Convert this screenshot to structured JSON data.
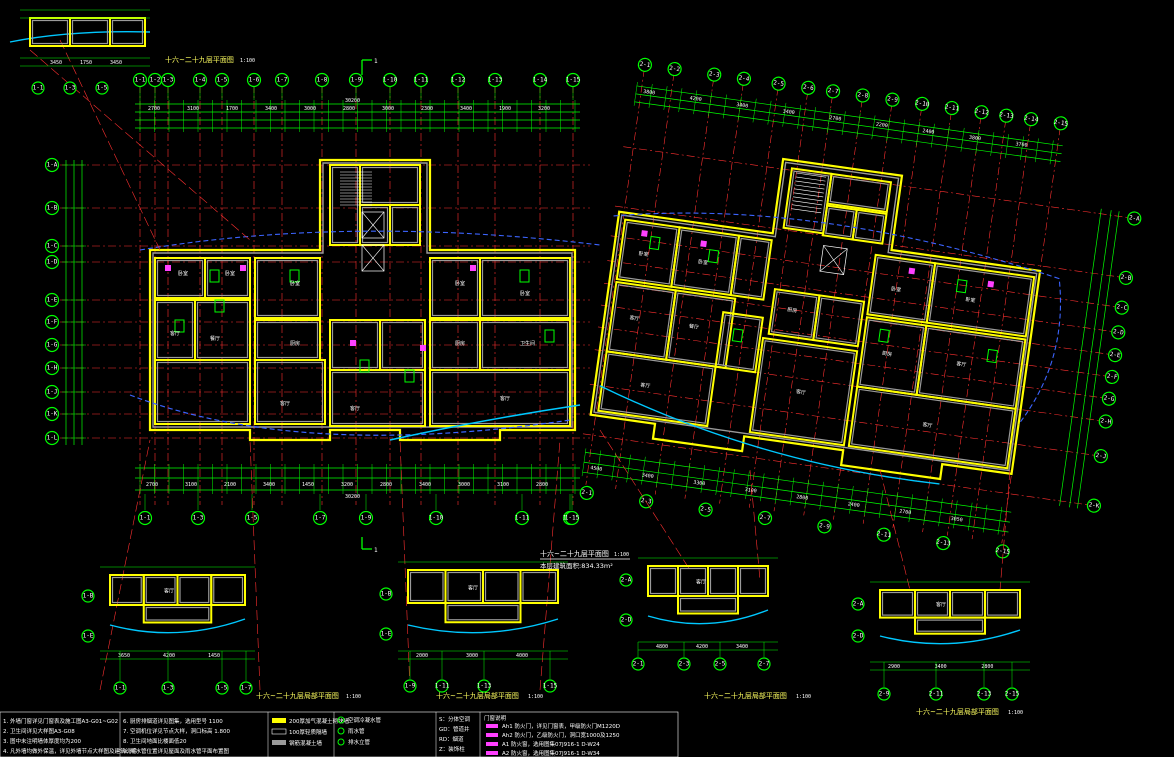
{
  "colors": {
    "background": "#000000",
    "wall": "#ffff00",
    "wall_fill": "#9a9a9a",
    "grid_line": "#ff3030",
    "dimension": "#00ff00",
    "bubble": "#00ff00",
    "text": "#ffffff",
    "cyan": "#00c8ff",
    "blue": "#3c64ff",
    "magenta": "#ff40ff"
  },
  "plan_main": {
    "title": "十六~二十九层平面图",
    "scale": "1:100",
    "area_label": "本层建筑面积:834.33m²",
    "section_mark": "1",
    "left_axes": [
      "1-1",
      "1-2",
      "1-3",
      "1-4",
      "1-5",
      "1-6",
      "1-7",
      "1-8",
      "1-9",
      "1-10",
      "1-11",
      "1-12",
      "1-13",
      "1-14",
      "1-15"
    ],
    "left_bottom_axes": [
      "1-1",
      "1-3",
      "1-5",
      "1-7",
      "1-9",
      "1-10",
      "1-11",
      "1-13",
      "1-15"
    ],
    "left_rows": [
      "1-A",
      "1-B",
      "1-C",
      "1-D",
      "1-E",
      "1-F",
      "1-G",
      "1-H",
      "1-J",
      "1-K",
      "1-L"
    ],
    "left_top_dims": [
      "2700",
      "3100",
      "1700",
      "3400",
      "3000",
      "2800",
      "3000",
      "2300",
      "3400",
      "1900",
      "3200"
    ],
    "left_bottom_dims": [
      "2700",
      "3100",
      "2100",
      "3400",
      "1450",
      "3200",
      "2800",
      "3400",
      "3000",
      "3100",
      "2800"
    ],
    "left_total": "30200",
    "right_axes": [
      "2-1",
      "2-2",
      "2-3",
      "2-4",
      "2-5",
      "2-6",
      "2-7",
      "2-8",
      "2-9",
      "2-10",
      "2-11",
      "2-12",
      "2-13",
      "2-14",
      "2-15"
    ],
    "right_rows": [
      "2-A",
      "2-B",
      "2-C",
      "2-D",
      "2-E",
      "2-F",
      "2-G",
      "2-H",
      "2-J",
      "2-K"
    ],
    "right_top_dims": [
      "3800",
      "4200",
      "3400",
      "3400",
      "2700",
      "2200",
      "2400",
      "3800",
      "3700"
    ],
    "right_bottom_dims": [
      "4500",
      "3400",
      "3300",
      "3100",
      "2800",
      "2400",
      "2700",
      "3050"
    ]
  },
  "detail_plans": [
    {
      "title": "十六~二十九层局部平面图",
      "scale": "1:100",
      "axes": [
        "1-1",
        "1-3",
        "1-5",
        "1-7"
      ],
      "rows": [
        "1-B",
        "1-E"
      ],
      "dims": [
        "3650",
        "4200",
        "1450"
      ]
    },
    {
      "title": "十六~二十九层局部平面图",
      "scale": "1:100",
      "axes": [
        "1-9",
        "1-11",
        "1-13",
        "1-15"
      ],
      "rows": [
        "1-B",
        "1-E"
      ],
      "dims": [
        "2000",
        "3000",
        "4000"
      ]
    },
    {
      "title": "十六~二十九层局部平面图",
      "scale": "1:100",
      "axes": [
        "2-1",
        "2-3",
        "2-5",
        "2-7"
      ],
      "rows": [
        "2-A",
        "2-D"
      ],
      "dims": [
        "4800",
        "4200",
        "3400"
      ]
    },
    {
      "title": "十六~二十九层局部平面图",
      "scale": "1:100",
      "axes": [
        "2-9",
        "2-11",
        "2-13",
        "2-15"
      ],
      "rows": [
        "2-A",
        "2-D"
      ],
      "dims": [
        "2900",
        "3400",
        "2800"
      ]
    },
    {
      "title": "十六~二十九层局部平面图",
      "scale": "1:100",
      "axes": [
        "1-1",
        "1-3",
        "1-5"
      ],
      "rows": [
        "1-H",
        "1-K"
      ],
      "dims": [
        "3450",
        "1750",
        "3450"
      ]
    }
  ],
  "legend": {
    "notes": [
      "1. 外墙门窗详见门窗表及施工图A3-G01~G02",
      "2. 卫生间详见大样图A3-G08",
      "3. 图中未注明墙体厚度均为200",
      "4. 凡外墙均做外保温，详见外墙节点大样图及建筑说明"
    ],
    "notes2": [
      "6. 厨房排烟道详见图集，选用型号 1100",
      "7. 空调机位详见节点大样，洞口标高 1.800",
      "8. 卫生间地面比楼面低20",
      "9. 雨水管位置详见屋面及雨水管平面布置图"
    ],
    "symbols": [
      "200厚加气混凝土砌块墙",
      "100厚轻质隔墙",
      "钢筋混凝土墙"
    ],
    "symbols2": [
      "空调冷凝水管",
      "雨水管",
      "排水立管"
    ],
    "codes": [
      "S：分体空调",
      "GD：管道井",
      "RD：烟道",
      "Z：装饰柱"
    ],
    "door_header": "门窗说明",
    "doors": [
      "Ah1 防火门，详见门窗表，甲级防火门M1220D",
      "Ah2 防火门，乙级防火门，洞口宽1000及1250",
      "A1 防火窗，选用图集07J916-1 D-W24",
      "A2 防火窗，选用图集07J916-1 D-W34"
    ]
  }
}
